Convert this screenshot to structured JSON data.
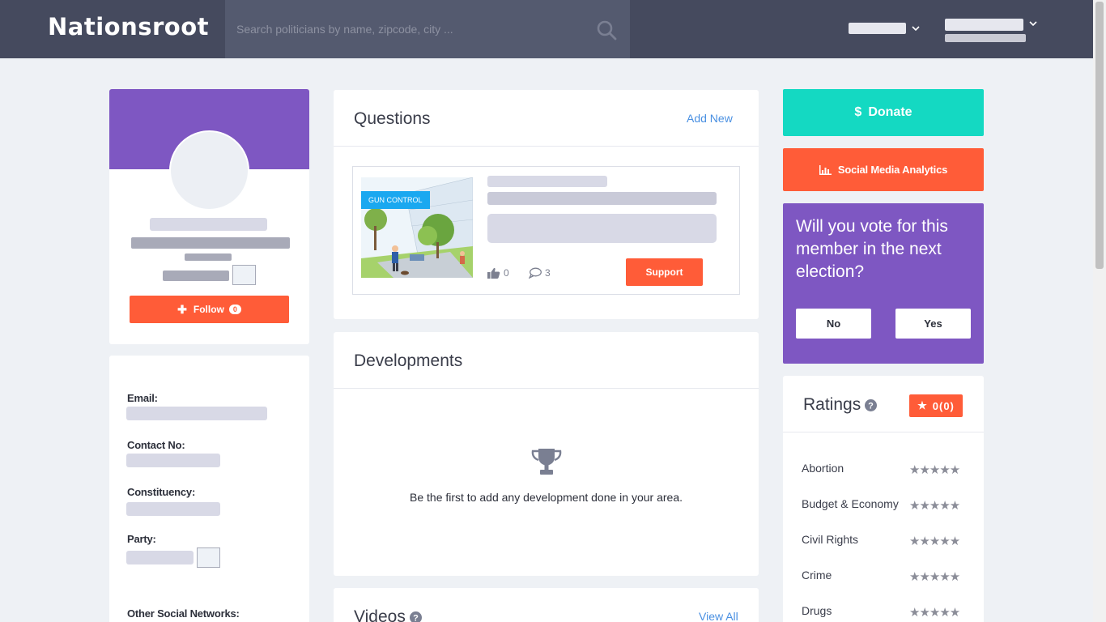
{
  "header": {
    "logo": "Nationsroot",
    "search_placeholder": "Search politicians by name, zipcode, city ..."
  },
  "profile": {
    "follow_label": "Follow",
    "follow_count": "0"
  },
  "info": {
    "email_label": "Email:",
    "contact_label": "Contact No:",
    "constituency_label": "Constituency:",
    "party_label": "Party:",
    "social_label": "Other Social Networks:"
  },
  "questions": {
    "title": "Questions",
    "add_new": "Add New",
    "item": {
      "tag": "GUN CONTROL",
      "likes": "0",
      "comments": "3",
      "support_label": "Support"
    }
  },
  "developments": {
    "title": "Developments",
    "empty_text": "Be the first to add any development done in your area."
  },
  "videos": {
    "title": "Videos",
    "view_all": "View All"
  },
  "actions": {
    "donate_label": "Donate",
    "donate_symbol": "$",
    "analytics_label": "Social Media Analytics"
  },
  "vote": {
    "question": "Will you vote for this member in the next election?",
    "no_label": "No",
    "yes_label": "Yes"
  },
  "ratings": {
    "title": "Ratings",
    "badge": "0(0)",
    "items": [
      {
        "name": "Abortion",
        "stars": "★★★★★"
      },
      {
        "name": "Budget & Economy",
        "stars": "★★★★★"
      },
      {
        "name": "Civil Rights",
        "stars": "★★★★★"
      },
      {
        "name": "Crime",
        "stars": "★★★★★"
      },
      {
        "name": "Drugs",
        "stars": "★★★★★"
      }
    ]
  },
  "colors": {
    "header_bg": "#454a5e",
    "purple": "#7e57c2",
    "orange": "#ff5c38",
    "teal": "#14d9c2",
    "link": "#4a90e2"
  }
}
